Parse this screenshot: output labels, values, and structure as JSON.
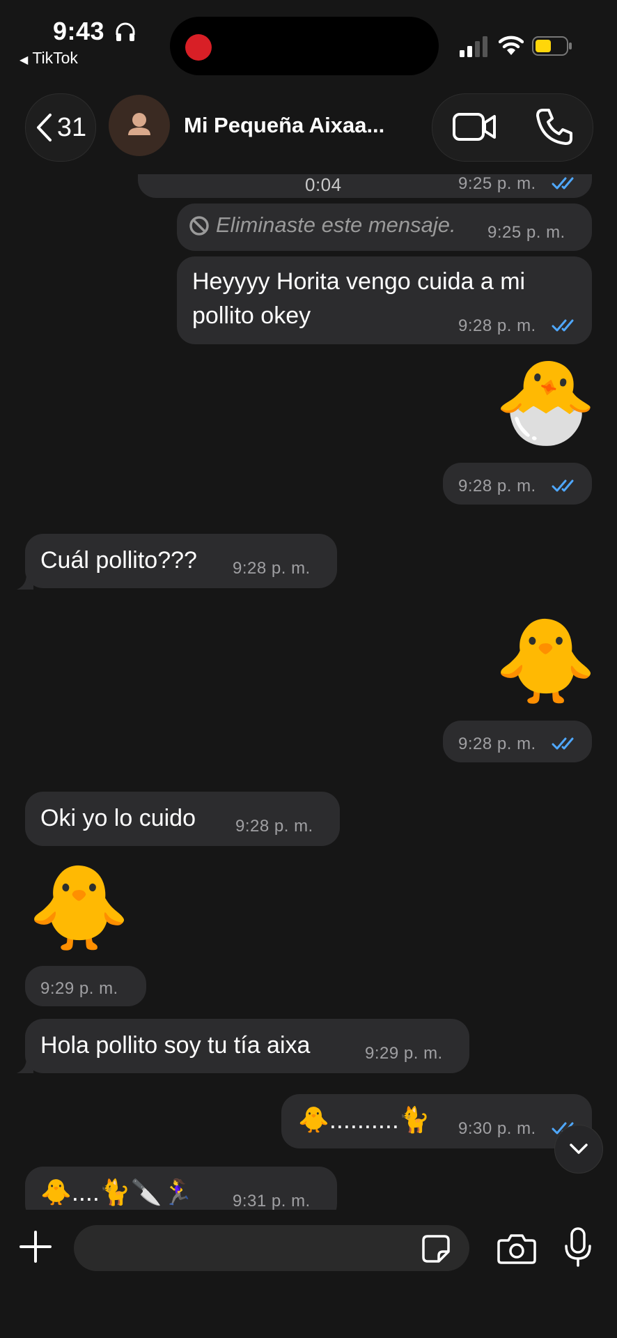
{
  "status_bar": {
    "time": "9:43",
    "back_app": "TikTok"
  },
  "header": {
    "back_count": "31",
    "contact_name": "Mi Pequeña Aixaa..."
  },
  "messages": [
    {
      "direction": "out",
      "type": "voice",
      "duration": "0:04",
      "time": "9:25 p. m.",
      "read": true
    },
    {
      "direction": "out",
      "type": "deleted",
      "text": "Eliminaste este mensaje.",
      "time": "9:25 p. m."
    },
    {
      "direction": "out",
      "type": "text",
      "line1": "Heyyyy Horita vengo cuida a mi",
      "line2": "pollito okey",
      "time": "9:28 p. m.",
      "read": true
    },
    {
      "direction": "out",
      "type": "emoji",
      "emoji": "🐣",
      "time": "9:28 p. m.",
      "read": true
    },
    {
      "direction": "in",
      "type": "text",
      "text": "Cuál pollito???",
      "time": "9:28 p. m."
    },
    {
      "direction": "out",
      "type": "emoji",
      "emoji": "🐥",
      "time": "9:28 p. m.",
      "read": true
    },
    {
      "direction": "in",
      "type": "text",
      "text": "Oki yo lo cuido",
      "time": "9:28 p. m."
    },
    {
      "direction": "in",
      "type": "emoji",
      "emoji": "🐥",
      "time": "9:29 p. m."
    },
    {
      "direction": "in",
      "type": "text",
      "text": "Hola pollito soy tu tía aixa",
      "time": "9:29 p. m."
    },
    {
      "direction": "out",
      "type": "text",
      "text": "🐥..........🐈",
      "time": "9:30 p. m.",
      "read": true
    },
    {
      "direction": "in",
      "type": "text",
      "text": "🐥....🐈🔪🏃‍♀️",
      "time": "9:31 p. m."
    }
  ],
  "composer": {
    "placeholder": ""
  },
  "colors": {
    "background": "#161616",
    "bubble": "#2c2c2e",
    "read_ticks": "#4fa8ff",
    "recording": "#d81f26",
    "battery": "#ffd60a"
  },
  "icons": [
    "headphones-icon",
    "signal-icon",
    "wifi-icon",
    "battery-icon",
    "chevron-left-icon",
    "person-icon",
    "video-call-icon",
    "phone-icon",
    "blocked-icon",
    "double-check-icon",
    "chevron-down-icon",
    "plus-icon",
    "sticker-icon",
    "camera-icon",
    "microphone-icon"
  ]
}
